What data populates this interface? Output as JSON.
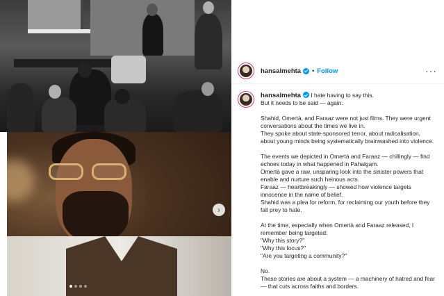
{
  "post": {
    "username": "hansalmehta",
    "separator": "•",
    "follow_label": "Follow",
    "more_icon": "more-horizontal-icon",
    "carousel": {
      "slide_count": 4,
      "active_index": 0
    }
  },
  "caption": {
    "username": "hansalmehta",
    "first_line": "I hate having to say this.",
    "lines": [
      "But it needs to be said — again.",
      "",
      "Shahid, Omertà, and Faraaz were not just films. They were urgent",
      "conversations about the times we live in.",
      "They spoke about state-sponsored terror, about radicalisation,",
      "about young minds being systematically brainwashed into violence.",
      "",
      "The events we depicted in Omertà and Faraaz — chillingly — find",
      "echoes today in what happened in Pahalgam.",
      "Omertà gave a raw, unsparing look into the sinister powers that",
      "enable and nurture such heinous acts.",
      "Faraaz — heartbreakingly — showed how violence targets",
      "innocence in the name of belief.",
      "Shahid was a plea for reform, for reclaiming our youth before they",
      "fall prey to hate.",
      "",
      "At the time, especially when Omertà and Faraaz released, I",
      "remember being targeted:",
      "\"Why this story?\"",
      "\"Why this focus?\"",
      "\"Are you targeting a community?\"",
      "",
      "No.",
      "These stories are about a system — a machinery of hatred and fear",
      "— that cuts across faiths and borders."
    ]
  },
  "colors": {
    "link_blue": "#0095f6",
    "text": "#262626"
  }
}
